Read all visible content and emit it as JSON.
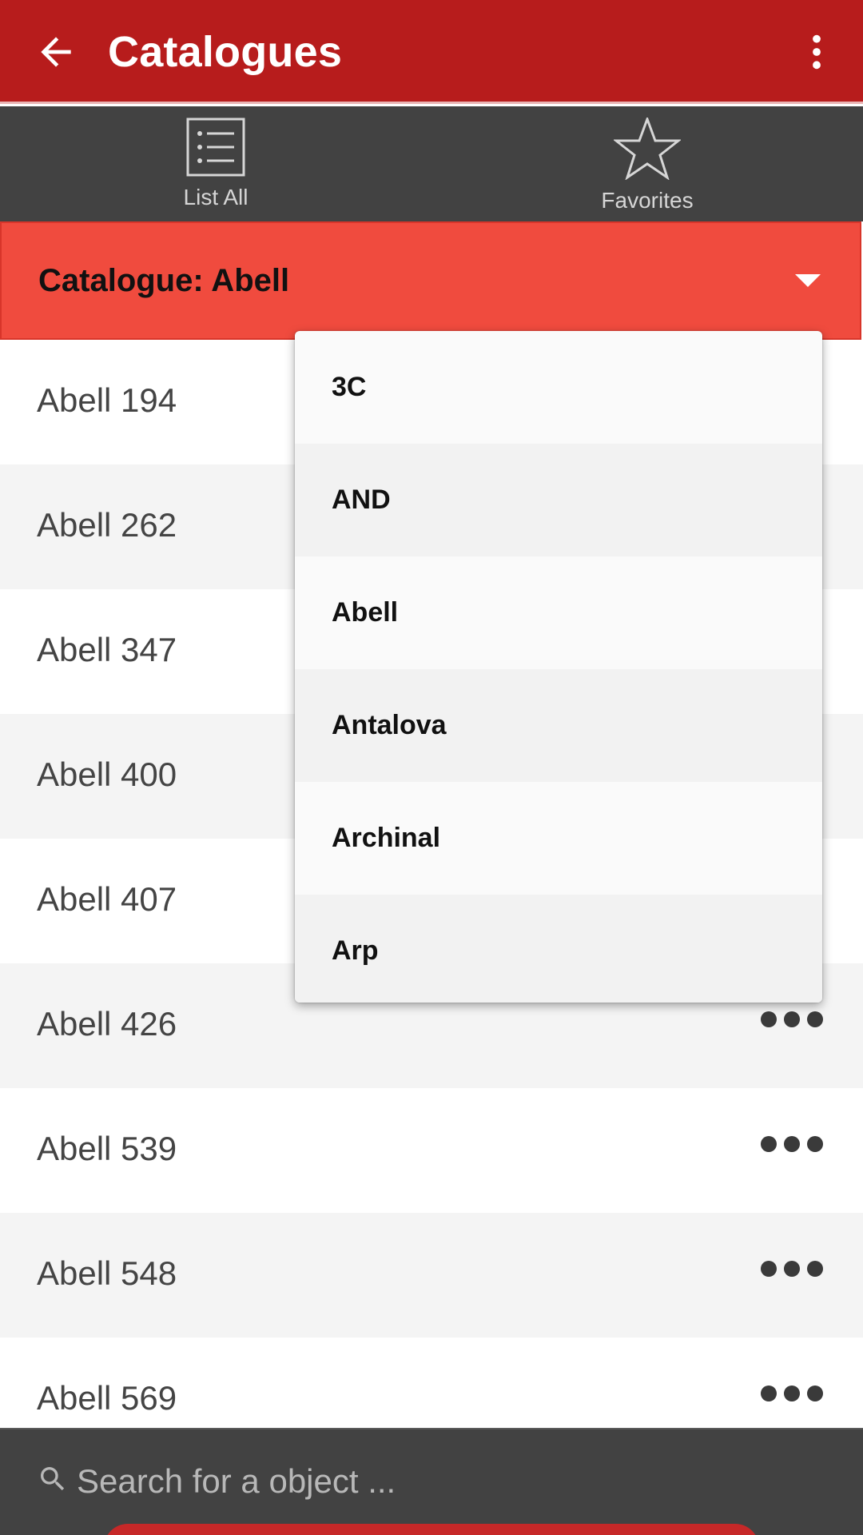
{
  "appbar": {
    "title": "Catalogues",
    "back_icon": "arrow-left-icon",
    "menu_icon": "more-vert-icon",
    "color": "#b71c1c"
  },
  "tabs": [
    {
      "label": "List All",
      "icon": "list-icon"
    },
    {
      "label": "Favorites",
      "icon": "star-outline-icon"
    }
  ],
  "catalogue": {
    "label": "Catalogue: Abell",
    "caret_icon": "caret-down-icon",
    "color": "#f04b3e"
  },
  "list": {
    "items": [
      {
        "name": "Abell 194"
      },
      {
        "name": "Abell 262"
      },
      {
        "name": "Abell 347"
      },
      {
        "name": "Abell 400"
      },
      {
        "name": "Abell 407"
      },
      {
        "name": "Abell 426"
      },
      {
        "name": "Abell 539"
      },
      {
        "name": "Abell 548"
      },
      {
        "name": "Abell 569"
      }
    ],
    "more_icon": "more-horiz-icon"
  },
  "dropdown": {
    "options": [
      "3C",
      "AND",
      "Abell",
      "Antalova",
      "Archinal",
      "Arp"
    ],
    "selected": "Abell"
  },
  "search": {
    "placeholder": "Search for a object ...",
    "value": "",
    "icon": "search-icon"
  }
}
